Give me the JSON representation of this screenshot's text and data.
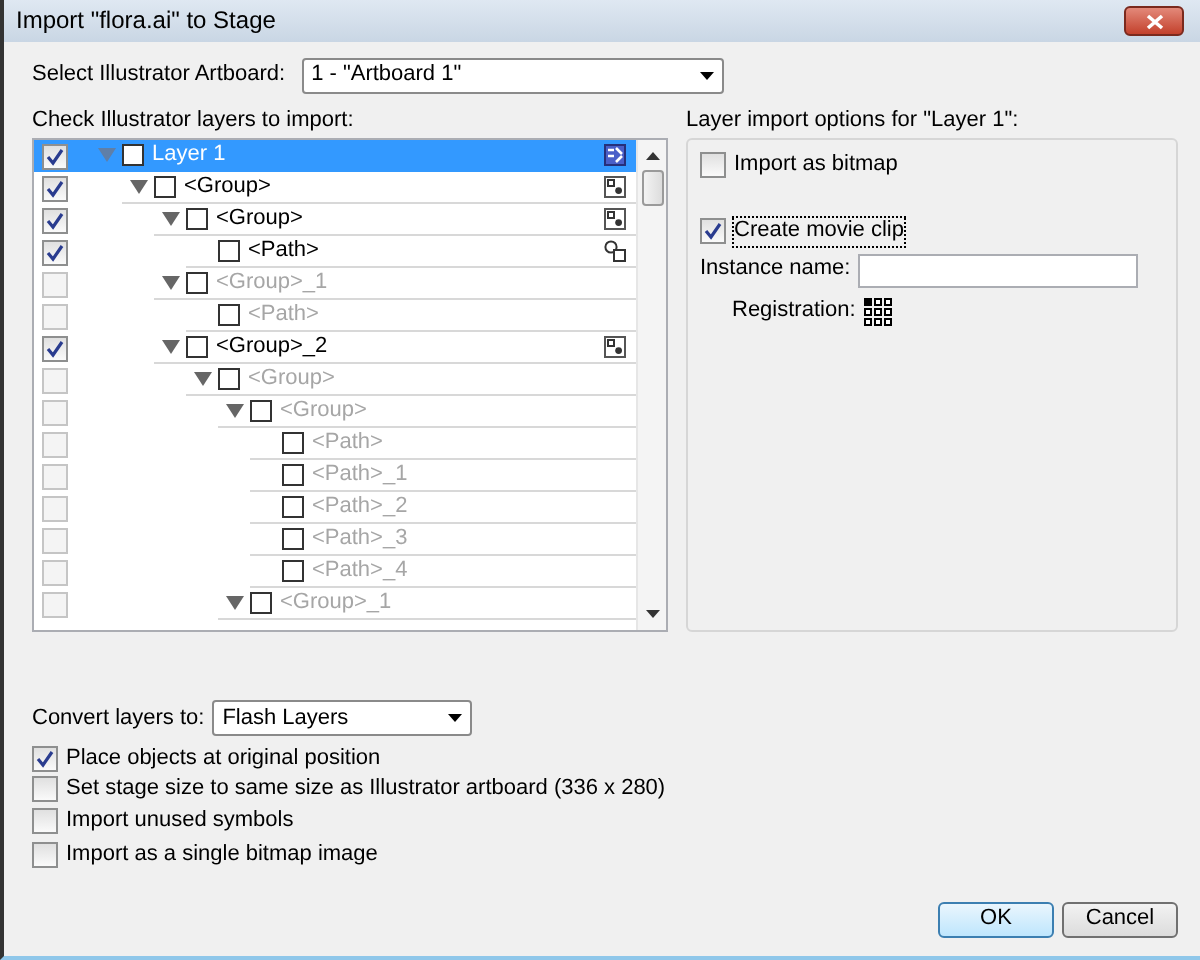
{
  "window": {
    "title": "Import \"flora.ai\" to Stage"
  },
  "artboard": {
    "label": "Select Illustrator Artboard:",
    "value": "1 - \"Artboard 1\""
  },
  "layers": {
    "label": "Check Illustrator layers to import:",
    "tree": [
      {
        "label": "Layer 1",
        "checked": true,
        "disabled": false,
        "selected": true,
        "expanded": true,
        "kind": "layer",
        "children": [
          {
            "label": "<Group>",
            "checked": true,
            "disabled": false,
            "selected": false,
            "expanded": true,
            "kind": "group",
            "children": [
              {
                "label": "<Group>",
                "checked": true,
                "disabled": false,
                "selected": false,
                "expanded": true,
                "kind": "group",
                "children": [
                  {
                    "label": "<Path>",
                    "checked": true,
                    "disabled": false,
                    "selected": false,
                    "kind": "path"
                  }
                ]
              },
              {
                "label": "<Group>_1",
                "checked": false,
                "disabled": true,
                "selected": false,
                "expanded": true,
                "children": [
                  {
                    "label": "<Path>",
                    "checked": false,
                    "disabled": true,
                    "selected": false
                  }
                ]
              },
              {
                "label": "<Group>_2",
                "checked": true,
                "disabled": false,
                "selected": false,
                "expanded": true,
                "kind": "group",
                "children": [
                  {
                    "label": "<Group>",
                    "checked": false,
                    "disabled": true,
                    "selected": false,
                    "expanded": true,
                    "children": [
                      {
                        "label": "<Group>",
                        "checked": false,
                        "disabled": true,
                        "selected": false,
                        "expanded": true,
                        "children": [
                          {
                            "label": "<Path>",
                            "checked": false,
                            "disabled": true,
                            "selected": false
                          },
                          {
                            "label": "<Path>_1",
                            "checked": false,
                            "disabled": true,
                            "selected": false
                          },
                          {
                            "label": "<Path>_2",
                            "checked": false,
                            "disabled": true,
                            "selected": false
                          },
                          {
                            "label": "<Path>_3",
                            "checked": false,
                            "disabled": true,
                            "selected": false
                          },
                          {
                            "label": "<Path>_4",
                            "checked": false,
                            "disabled": true,
                            "selected": false
                          }
                        ]
                      },
                      {
                        "label": "<Group>_1",
                        "checked": false,
                        "disabled": true,
                        "selected": false,
                        "expanded": true
                      }
                    ]
                  }
                ]
              }
            ]
          }
        ]
      }
    ]
  },
  "options": {
    "label": "Layer import options for \"Layer 1\":",
    "import_bitmap": {
      "label": "Import as bitmap",
      "checked": false
    },
    "movie_clip": {
      "label": "Create movie clip",
      "checked": true
    },
    "instance": {
      "label": "Instance name:"
    },
    "registration": {
      "label": "Registration:",
      "points": [
        {
          "selected": true
        },
        {
          "selected": false
        },
        {
          "selected": false
        },
        {
          "selected": false
        },
        {
          "selected": false
        },
        {
          "selected": false
        },
        {
          "selected": false
        },
        {
          "selected": false
        },
        {
          "selected": false
        }
      ]
    }
  },
  "convert": {
    "label": "Convert layers to:",
    "value": "Flash Layers"
  },
  "checks": [
    {
      "label": "Place objects at original position",
      "checked": true
    },
    {
      "label": "Set stage size to same size as Illustrator artboard (336 x 280)",
      "checked": false
    },
    {
      "label": "Import unused symbols",
      "checked": false
    },
    {
      "label": "Import as a single bitmap image",
      "checked": false
    }
  ],
  "buttons": [
    {
      "label": "OK",
      "default": true
    },
    {
      "label": "Cancel",
      "default": false
    }
  ]
}
